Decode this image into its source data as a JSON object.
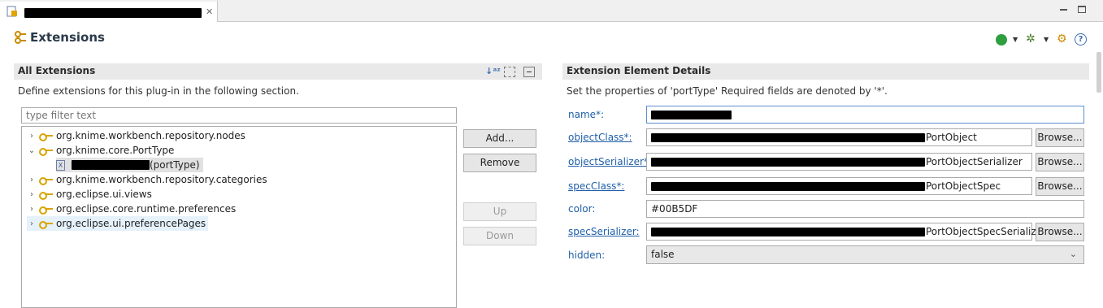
{
  "editor": {
    "tab_close": "✕",
    "page_title": "Extensions"
  },
  "all_extensions": {
    "title": "All Extensions",
    "description": "Define extensions for this plug-in in the following section.",
    "filter_placeholder": "type filter text",
    "tree": [
      {
        "label": "org.knime.workbench.repository.nodes",
        "expanded": false
      },
      {
        "label": "org.knime.core.PortType",
        "expanded": true
      },
      {
        "label": "(portType)",
        "child": true
      },
      {
        "label": "org.knime.workbench.repository.categories",
        "expanded": false
      },
      {
        "label": "org.eclipse.ui.views",
        "expanded": false
      },
      {
        "label": "org.eclipse.core.runtime.preferences",
        "expanded": false
      },
      {
        "label": "org.eclipse.ui.preferencePages",
        "expanded": false
      }
    ],
    "buttons": {
      "add": "Add...",
      "remove": "Remove",
      "up": "Up",
      "down": "Down"
    }
  },
  "details": {
    "title": "Extension Element Details",
    "description": "Set the properties of 'portType' Required fields are denoted by '*'.",
    "fields": {
      "name_label": "name*:",
      "objectClass_label": "objectClass*:",
      "objectClass_suffix": "PortObject",
      "objectSerializer_label": "objectSerializer*:",
      "objectSerializer_suffix": "PortObjectSerializer",
      "specClass_label": "specClass*:",
      "specClass_suffix": "PortObjectSpec",
      "color_label": "color:",
      "color_value": "#00B5DF",
      "specSerializer_label": "specSerializer:",
      "specSerializer_suffix": "PortObjectSpecSerializer",
      "hidden_label": "hidden:",
      "hidden_value": "false"
    },
    "browse": "Browse..."
  },
  "colors": {
    "link": "#1f5fa8",
    "header_bg": "#e9e9e9",
    "selected_row": "#e5f1fb"
  }
}
